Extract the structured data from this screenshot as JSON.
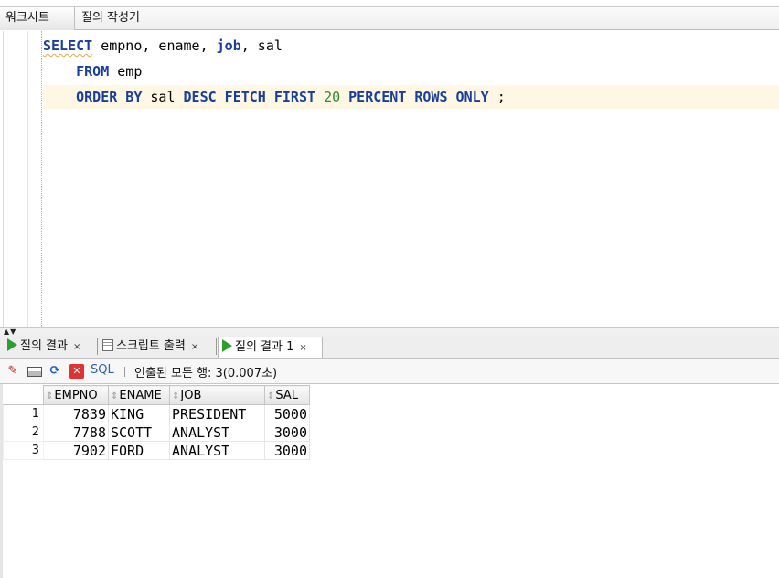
{
  "top_tabs": {
    "worksheet": "워크시트",
    "query_builder": "질의 작성기"
  },
  "editor": {
    "line1": {
      "kw1": "SELECT",
      "p1": " empno, ename, ",
      "kw2": "job",
      "p2": ", sal"
    },
    "line2": {
      "indent": "    ",
      "kw1": "FROM",
      "p1": " emp"
    },
    "line3": {
      "indent": "    ",
      "kw1": "ORDER BY",
      "p1": " sal ",
      "kw2": "DESC FETCH FIRST",
      "sp1": " ",
      "num": "20",
      "sp2": " ",
      "kw3": "PERCENT ROWS ONLY",
      "p2": " ;"
    }
  },
  "result_tabs": [
    {
      "label": "질의 결과",
      "close": "×"
    },
    {
      "label": "스크립트 출력",
      "close": "×"
    },
    {
      "label": "질의 결과 1",
      "close": "×"
    }
  ],
  "toolbar": {
    "sql_label": "SQL",
    "fetch_status": "인출된 모든 행: 3(0.007초)"
  },
  "grid": {
    "columns": [
      "EMPNO",
      "ENAME",
      "JOB",
      "SAL"
    ],
    "rows": [
      {
        "num": "1",
        "empno": "7839",
        "ename": "KING",
        "job": "PRESIDENT",
        "sal": "5000"
      },
      {
        "num": "2",
        "empno": "7788",
        "ename": "SCOTT",
        "job": "ANALYST",
        "sal": "3000"
      },
      {
        "num": "3",
        "empno": "7902",
        "ename": "FORD",
        "job": "ANALYST",
        "sal": "3000"
      }
    ]
  }
}
